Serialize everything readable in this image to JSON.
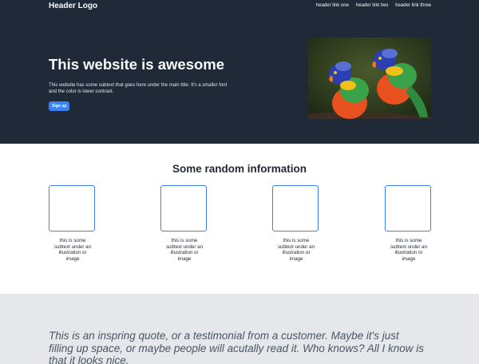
{
  "header": {
    "logo": "Header Logo",
    "links": [
      "header link one",
      "header link two",
      "header link three"
    ]
  },
  "hero": {
    "title": "This website is awesome",
    "subtext": "This website has some subtext that goes here under the main title. It's a smaller font and the color is lower contrast.",
    "button_label": "Sign up",
    "image_alt": "parrots"
  },
  "info": {
    "title": "Some random information",
    "cards": [
      "this is some subtext under an illustration or image",
      "this is some subtext under an illustration or image",
      "this is some subtext under an illustration or image",
      "this is some subtext under an illustration or image"
    ]
  },
  "quote": {
    "text": "This is an inspring quote, or a testimonial from a customer. Maybe it's just filling up space, or maybe people will acutally read it. Who knows? All I know is that it looks nice."
  },
  "colors": {
    "hero_bg": "#1f2937",
    "accent": "#3b82f6",
    "quote_bg": "#e5e7eb"
  }
}
